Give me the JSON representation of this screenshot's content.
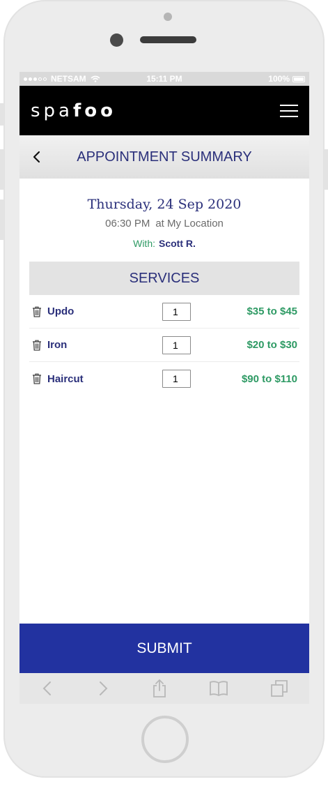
{
  "status_bar": {
    "carrier": "NETSAM",
    "time": "15:11 PM",
    "battery": "100%"
  },
  "header": {
    "logo_light": "spa",
    "logo_bold": "foo"
  },
  "nav": {
    "title": "APPOINTMENT SUMMARY"
  },
  "appointment": {
    "date": "Thursday, 24 Sep 2020",
    "time": "06:30 PM",
    "location": "at My Location",
    "with_label": "With:",
    "with_name": "Scott R."
  },
  "services": {
    "heading": "SERVICES",
    "items": [
      {
        "name": "Updo",
        "qty": "1",
        "price": "$35 to $45"
      },
      {
        "name": "Iron",
        "qty": "1",
        "price": "$20 to $30"
      },
      {
        "name": "Haircut",
        "qty": "1",
        "price": "$90 to $110"
      }
    ]
  },
  "actions": {
    "submit_label": "SUBMIT"
  },
  "colors": {
    "primary": "#2232a0",
    "title_text": "#2a2f7a",
    "price_green": "#2e9a64",
    "header_bg": "#000000"
  },
  "icons": [
    "back-chevron-icon",
    "hamburger-menu-icon",
    "trash-icon",
    "browser-back-icon",
    "browser-forward-icon",
    "share-icon",
    "bookmarks-icon",
    "tabs-icon",
    "wifi-icon",
    "battery-icon"
  ]
}
